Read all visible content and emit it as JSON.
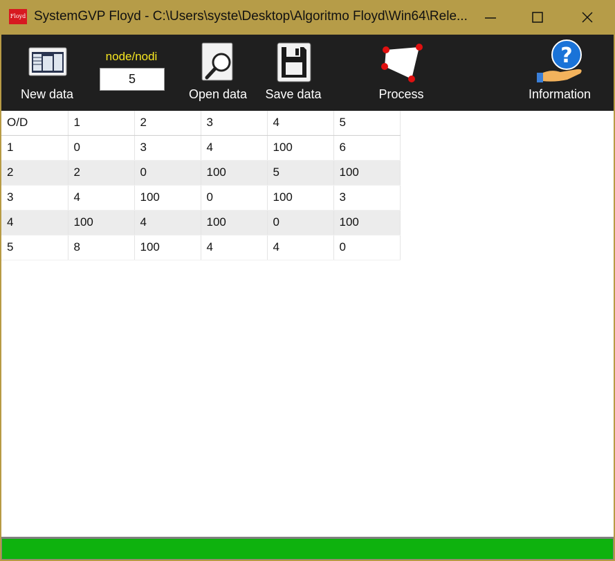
{
  "window": {
    "title": "SystemGVP Floyd - C:\\Users\\syste\\Desktop\\Algoritmo Floyd\\Win64\\Rele...",
    "app_icon_text": "Floyd",
    "minimize": "—",
    "maximize": "☐",
    "close": "✕"
  },
  "toolbar": {
    "new_data": "New data",
    "node_label": "node/nodi",
    "node_value": "5",
    "open_data": "Open data",
    "save_data": "Save data",
    "process": "Process",
    "information": "Information"
  },
  "grid": {
    "headers": [
      "O/D",
      "1",
      "2",
      "3",
      "4",
      "5"
    ],
    "rows": [
      [
        "1",
        "0",
        "3",
        "4",
        "100",
        "6"
      ],
      [
        "2",
        "2",
        "0",
        "100",
        "5",
        "100"
      ],
      [
        "3",
        "4",
        "100",
        "0",
        "100",
        "3"
      ],
      [
        "4",
        "100",
        "4",
        "100",
        "0",
        "100"
      ],
      [
        "5",
        "8",
        "100",
        "4",
        "4",
        "0"
      ]
    ]
  },
  "status": {
    "progress": 1.0,
    "color": "#0eb20e"
  },
  "colors": {
    "titlebar": "#b69c48",
    "toolbar": "#1f1f1f",
    "node_label": "#f6e620",
    "app_icon": "#d71920"
  }
}
